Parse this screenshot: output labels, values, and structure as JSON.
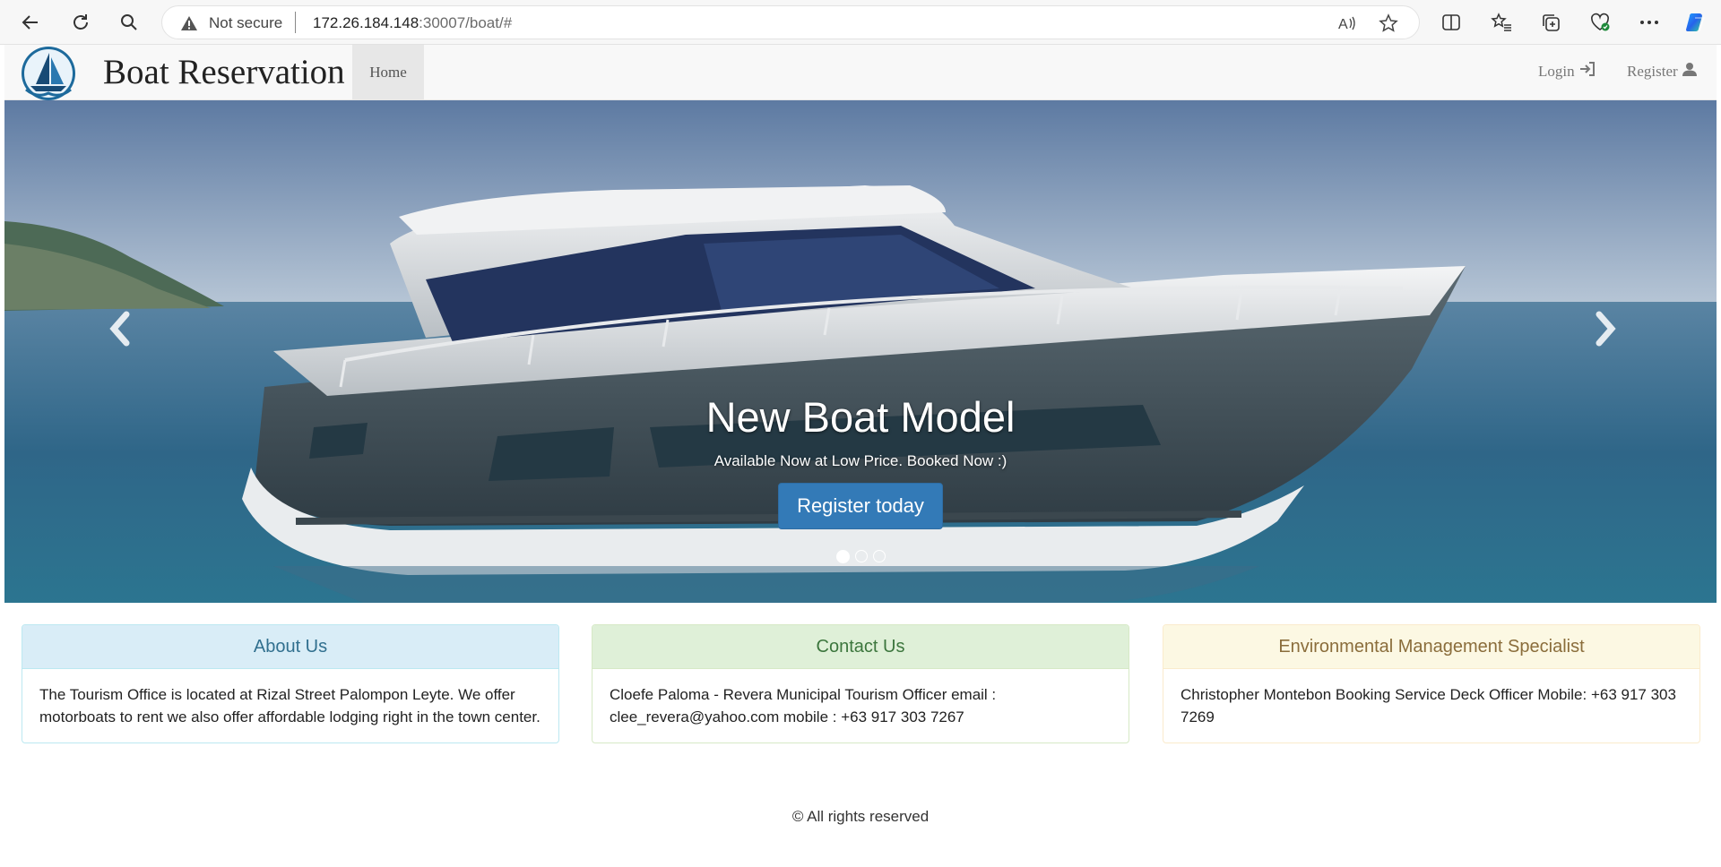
{
  "browser": {
    "security_label": "Not secure",
    "url_host": "172.26.184.148",
    "url_rest": ":30007/boat/#"
  },
  "navbar": {
    "brand": "Boat Reservation",
    "home": "Home",
    "login": "Login",
    "register": "Register"
  },
  "carousel": {
    "title": "New Boat Model",
    "subtitle": "Available Now at Low Price. Booked Now :)",
    "button": "Register today",
    "slide_count": 3,
    "active_slide": 1
  },
  "panels": [
    {
      "title": "About Us",
      "body": "The Tourism Office is located at Rizal Street Palompon Leyte. We offer motorboats to rent we also offer affordable lodging right in the town center."
    },
    {
      "title": "Contact Us",
      "body": "Cloefe Paloma - Revera Municipal Tourism Officer email : clee_revera@yahoo.com mobile : +63 917 303 7267"
    },
    {
      "title": "Environmental Management Specialist",
      "body": "Christopher Montebon Booking Service Deck Officer Mobile: +63 917 303 7269"
    }
  ],
  "footer": "© All rights reserved",
  "colors": {
    "primary": "#337ab7",
    "info_bg": "#d9edf7",
    "success_bg": "#dff0d8",
    "warning_bg": "#fcf8e3"
  }
}
